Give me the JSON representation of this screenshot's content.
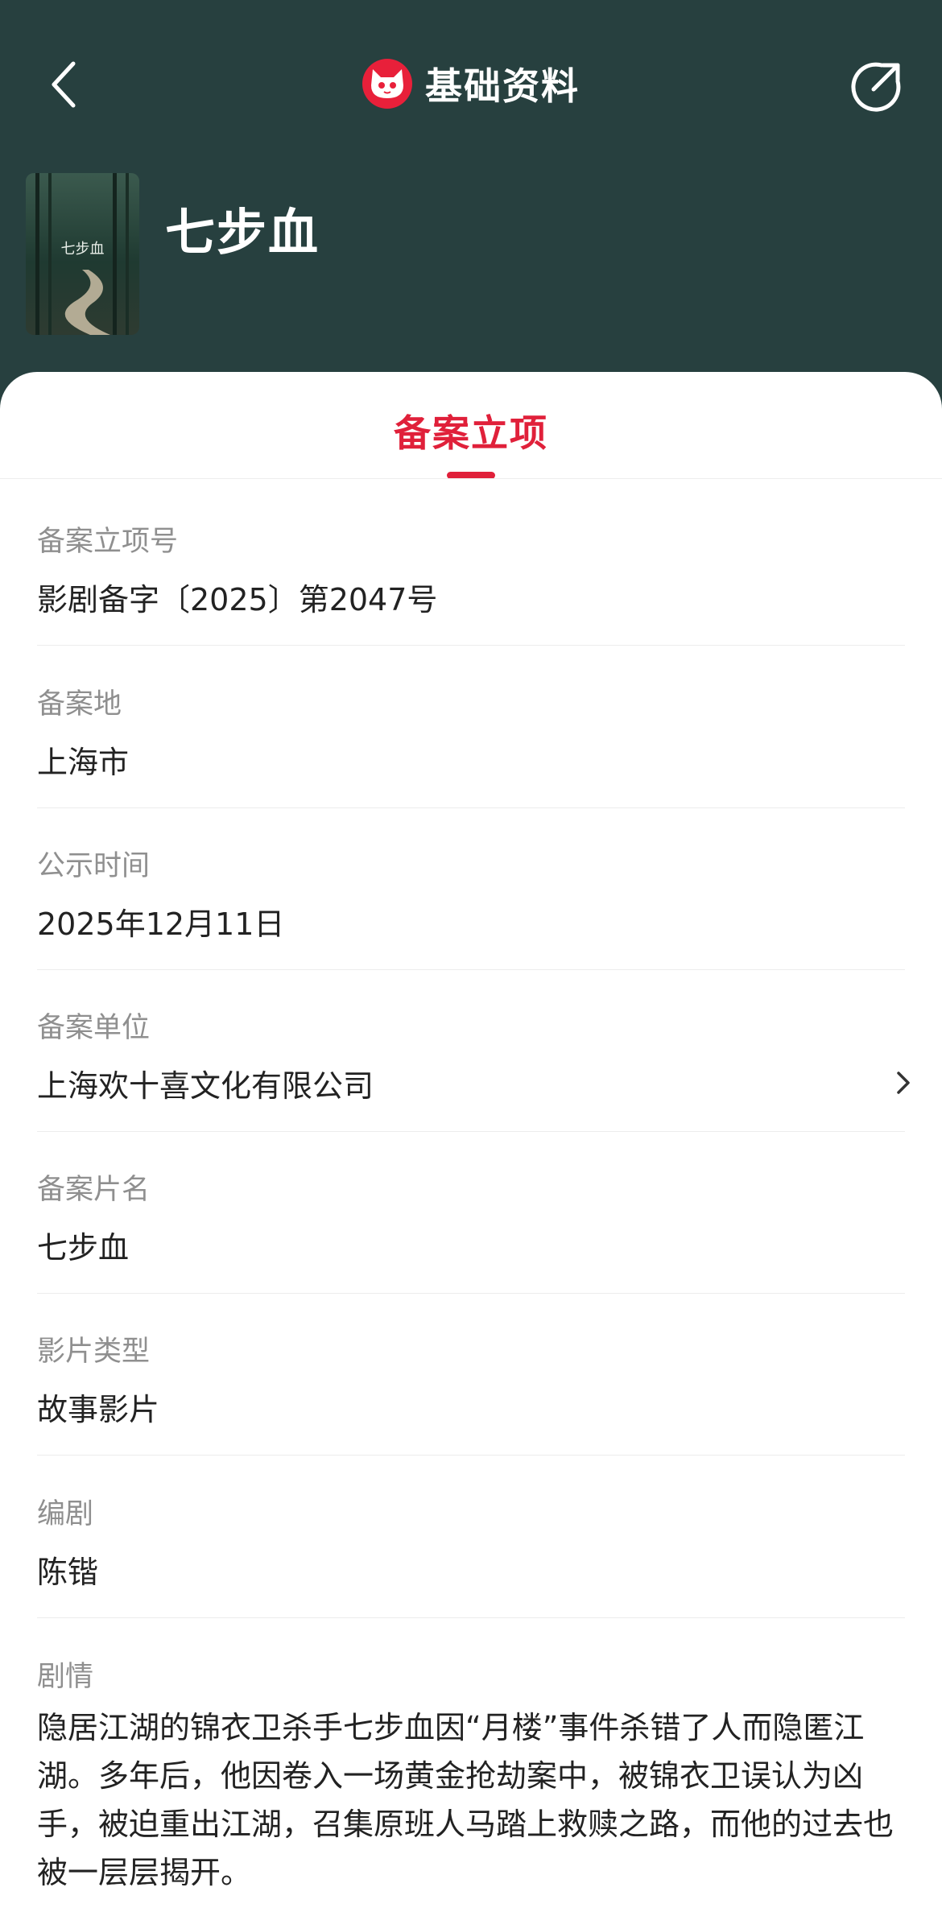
{
  "header": {
    "title": "基础资料",
    "back_icon": "back-icon",
    "share_icon": "share-icon",
    "logo_icon": "cat-logo-icon"
  },
  "movie": {
    "title": "七步血",
    "poster_text": "七步血"
  },
  "tabs": [
    {
      "label": "备案立项",
      "active": true
    }
  ],
  "fields": [
    {
      "label": "备案立项号",
      "value": "影剧备字〔2025〕第2047号"
    },
    {
      "label": "备案地",
      "value": "上海市"
    },
    {
      "label": "公示时间",
      "value": "2025年12月11日"
    },
    {
      "label": "备案单位",
      "value": "上海欢十喜文化有限公司"
    },
    {
      "label": "备案片名",
      "value": "七步血"
    },
    {
      "label": "影片类型",
      "value": "故事影片"
    },
    {
      "label": "编剧",
      "value": "陈锴"
    }
  ],
  "plot": {
    "label": "剧情",
    "text": "隐居江湖的锦衣卫杀手七步血因“月楼”事件杀错了人而隐匿江湖。多年后，他因卷入一场黄金抢劫案中，被锦衣卫误认为凶手，被迫重出江湖，召集原班人马踏上救赎之路，而他的过去也被一层层揭开。"
  },
  "colors": {
    "header_bg": "#27403f",
    "accent": "#e0203a"
  }
}
